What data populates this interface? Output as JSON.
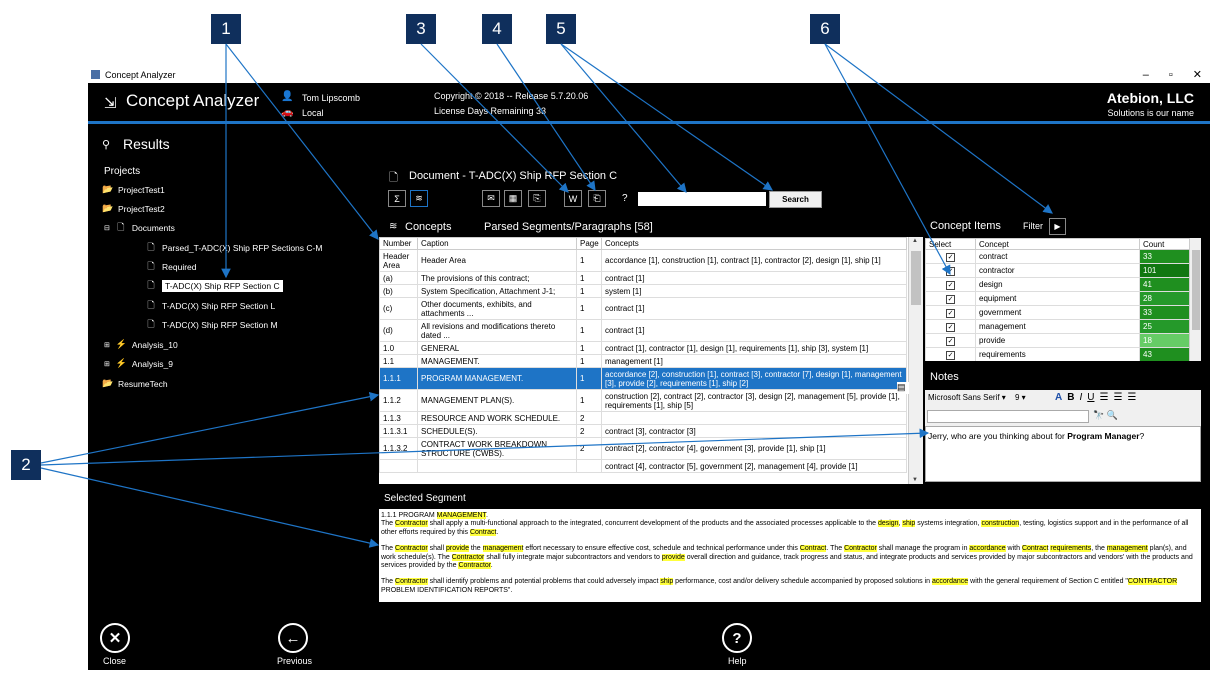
{
  "callouts": [
    "1",
    "2",
    "3",
    "4",
    "5",
    "6"
  ],
  "window": {
    "title": "Concept Analyzer",
    "min": "–",
    "max": "▫",
    "close": "✕"
  },
  "header": {
    "app_title": "Concept Analyzer",
    "user": "Tom Lipscomb",
    "location": "Local",
    "copyright": "Copyright © 2018 -- Release 5.7.20.06",
    "license": "License Days Remaining  33",
    "brand": "Atebion, LLC",
    "slogan": "Solutions is our name"
  },
  "results": {
    "title": "Results",
    "projects_label": "Projects",
    "tree": [
      {
        "label": "ProjectTest1",
        "icon": "folder-open-icon"
      },
      {
        "label": "ProjectTest2",
        "icon": "folder-open-icon"
      },
      {
        "label": "Documents",
        "icon": "document-icon",
        "expander": "⊟"
      },
      {
        "label": "Parsed_T-ADC(X) Ship RFP Sections C-M",
        "icon": "document-icon"
      },
      {
        "label": "Required",
        "icon": "document-icon"
      },
      {
        "label": "T-ADC(X) Ship RFP Section C",
        "icon": "document-icon",
        "selected": true
      },
      {
        "label": "T-ADC(X) Ship RFP Section L",
        "icon": "document-icon"
      },
      {
        "label": "T-ADC(X) Ship RFP Section M",
        "icon": "document-icon"
      },
      {
        "label": "Analysis_10",
        "icon": "lightning-icon",
        "expander": "⊞"
      },
      {
        "label": "Analysis_9",
        "icon": "lightning-icon",
        "expander": "⊞"
      },
      {
        "label": "ResumeTech",
        "icon": "folder-open-icon"
      }
    ]
  },
  "document": {
    "title": "Document - T-ADC(X) Ship RFP Section C",
    "question": "?",
    "search_value": "",
    "search_button": "Search"
  },
  "concepts_tab": "Concepts",
  "parsed_label": "Parsed Segments/Paragraphs [58]",
  "grid": {
    "headers": [
      "Number",
      "Caption",
      "Page",
      "Concepts"
    ],
    "rows": [
      [
        "Header Area",
        "Header Area",
        "1",
        "accordance [1], construction [1], contract [1], contractor [2], design [1], ship [1]"
      ],
      [
        "(a)",
        "The provisions of this contract;",
        "1",
        "contract [1]"
      ],
      [
        "(b)",
        "System Specification, Attachment J-1;",
        "1",
        "system [1]"
      ],
      [
        "(c)",
        "Other documents, exhibits, and attachments ...",
        "1",
        "contract [1]"
      ],
      [
        "(d)",
        "All revisions and modifications thereto dated ...",
        "1",
        "contract [1]"
      ],
      [
        "1.0",
        "GENERAL",
        "1",
        "contract [1], contractor [1], design [1], requirements [1], ship [3], system [1]"
      ],
      [
        "1.1",
        "MANAGEMENT.",
        "1",
        "management [1]"
      ],
      [
        "1.1.1",
        "PROGRAM MANAGEMENT.",
        "1",
        "accordance [2], construction [1], contract [3], contractor [7], design [1], management [3], provide [2], requirements [1], ship [2]"
      ],
      [
        "1.1.2",
        "MANAGEMENT PLAN(S).",
        "1",
        "construction [2], contract [2], contractor [3], design [2], management [5], provide [1], requirements [1], ship [5]"
      ],
      [
        "1.1.3",
        "RESOURCE AND WORK SCHEDULE.",
        "2",
        ""
      ],
      [
        "1.1.3.1",
        "SCHEDULE(S).",
        "2",
        "contract [3], contractor [3]"
      ],
      [
        "1.1.3.2",
        "CONTRACT WORK BREAKDOWN STRUCTURE (CWBS).",
        "2",
        "contract [2], contractor [4], government [3], provide [1], ship [1]"
      ],
      [
        "",
        "",
        "",
        "contract [4], contractor [5], government [2], management [4], provide [1]"
      ]
    ],
    "selected_row": 7
  },
  "concept_items": {
    "title": "Concept Items",
    "filter": "Filter",
    "headers": [
      "Select",
      "Concept",
      "Count"
    ],
    "rows": [
      [
        "contract",
        "33",
        "#1f8f1f"
      ],
      [
        "contractor",
        "101",
        "#117711"
      ],
      [
        "design",
        "41",
        "#1f8f1f"
      ],
      [
        "equipment",
        "28",
        "#25992a"
      ],
      [
        "government",
        "33",
        "#1f8f1f"
      ],
      [
        "management",
        "25",
        "#25992a"
      ],
      [
        "provide",
        "18",
        "#66cc66"
      ],
      [
        "requirements",
        "43",
        "#1f8f1f"
      ]
    ]
  },
  "notes": {
    "title": "Notes",
    "font": "Microsoft Sans Serif",
    "size": "9",
    "text_prefix": "Jerry, who are you thinking about for ",
    "text_bold": "Program Manager",
    "text_suffix": "?"
  },
  "segment": {
    "title": "Selected Segment"
  },
  "nav": {
    "close": "Close",
    "previous": "Previous",
    "help": "Help"
  },
  "colors": {
    "accent": "#1e74c6",
    "callout": "#0f2f5c",
    "highlight": "#ffff3c"
  }
}
